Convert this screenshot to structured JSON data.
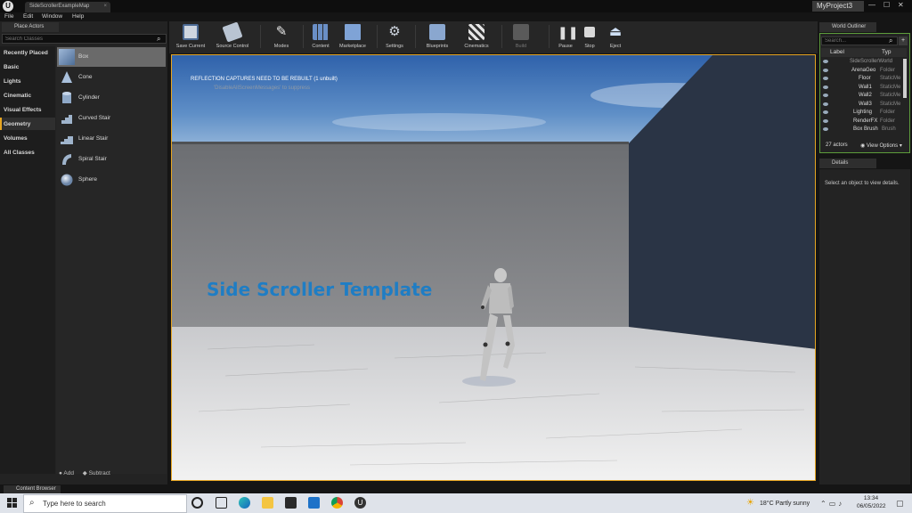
{
  "window": {
    "logo": "U",
    "map_tab": "SideScrollerExampleMap",
    "map_tab_close": "×",
    "project_name": "MyProject3",
    "minimize": "—",
    "maximize": "☐",
    "close": "✕"
  },
  "menu": [
    "File",
    "Edit",
    "Window",
    "Help"
  ],
  "place_actors": {
    "tab_label": "Place Actors",
    "search_placeholder": "Search Classes",
    "categories": [
      "Recently Placed",
      "Basic",
      "Lights",
      "Cinematic",
      "Visual Effects",
      "Geometry",
      "Volumes",
      "All Classes"
    ],
    "active_category": "Geometry",
    "items": [
      "Box",
      "Cone",
      "Cylinder",
      "Curved Stair",
      "Linear Stair",
      "Spiral Stair",
      "Sphere"
    ],
    "selected_item": "Box",
    "add_label": "Add",
    "subtract_label": "Subtract"
  },
  "toolbar": {
    "buttons": [
      "Save Current",
      "Source Control",
      "Modes",
      "Content",
      "Marketplace",
      "Settings",
      "Blueprints",
      "Cinematics",
      "Build",
      "Pause",
      "Stop",
      "Eject"
    ]
  },
  "viewport": {
    "message_primary": "REFLECTION CAPTURES NEED TO BE REBUILT (1 unbuilt)",
    "message_secondary": "'DisableAllScreenMessages' to suppress",
    "overlay_title": "Side Scroller Template"
  },
  "world_outliner": {
    "tab_label": "World Outliner",
    "search_placeholder": "Search...",
    "col_label": "Label",
    "col_type": "Typ",
    "rows": [
      {
        "name": "SideScrollerWorld",
        "type": ""
      },
      {
        "name": "ArenaGeo",
        "type": "Folder"
      },
      {
        "name": "Floor",
        "type": "StaticMe"
      },
      {
        "name": "Wall1",
        "type": "StaticMe"
      },
      {
        "name": "Wall2",
        "type": "StaticMe"
      },
      {
        "name": "Wall3",
        "type": "StaticMe"
      },
      {
        "name": "Lighting",
        "type": "Folder"
      },
      {
        "name": "RenderFX",
        "type": "Folder"
      },
      {
        "name": "Box Brush",
        "type": "Brush"
      }
    ],
    "actor_count": "27 actors",
    "view_options": "View Options"
  },
  "details": {
    "tab_label": "Details",
    "empty_message": "Select an object to view details."
  },
  "content_browser": {
    "tab_label": "Content Browser"
  },
  "taskbar": {
    "search_placeholder": "Type here to search",
    "weather": "18°C  Partly sunny",
    "time": "13:34",
    "date": "06/05/2022"
  },
  "colors": {
    "accent_orange": "#e6a521",
    "outliner_border": "#5d9c3b",
    "overlay_title": "#1f7dc4"
  }
}
